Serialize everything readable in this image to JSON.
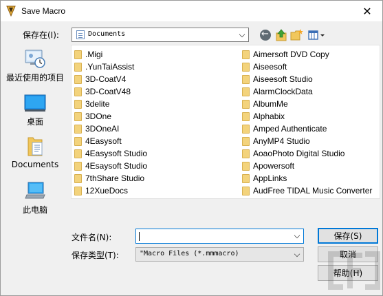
{
  "window": {
    "title": "Save Macro",
    "close_glyph": "✕"
  },
  "toolbar": {
    "savein_label": "保存在(I):",
    "savein_value": "Documents",
    "back_icon": "back-arrow-icon",
    "up_icon": "up-folder-icon",
    "newfolder_icon": "new-folder-icon",
    "views_icon": "views-menu-icon"
  },
  "places": [
    {
      "label": "最近使用的项目",
      "icon": "recent-items-icon"
    },
    {
      "label": "桌面",
      "icon": "desktop-icon"
    },
    {
      "label": "Documents",
      "icon": "documents-icon"
    },
    {
      "label": "此电脑",
      "icon": "this-pc-icon"
    }
  ],
  "files": {
    "column1": [
      ".Migi",
      ".YunTaiAssist",
      "3D-CoatV4",
      "3D-CoatV48",
      "3delite",
      "3DOne",
      "3DOneAI",
      "4Easysoft",
      "4Easysoft Studio",
      "4Esaysoft Studio",
      "7thShare Studio",
      "12XueDocs"
    ],
    "column2": [
      "Aimersoft DVD Copy",
      "Aiseesoft",
      "Aiseesoft Studio",
      "AlarmClockData",
      "AlbumMe",
      "Alphabix",
      "Amped Authenticate",
      "AnyMP4 Studio",
      "AoaoPhoto Digital Studio",
      "Apowersoft",
      "AppLinks",
      "AudFree TIDAL Music Converter"
    ]
  },
  "form": {
    "filename_label": "文件名(N):",
    "filename_value": "",
    "filetype_label": "保存类型(T):",
    "filetype_value": "\"Macro Files (*.mmmacro)"
  },
  "buttons": {
    "save": "保存(S)",
    "cancel": "取消",
    "help": "帮助(H)"
  },
  "colors": {
    "accent": "#0078d7",
    "folder": "#f3d37c",
    "dialog_bg": "#f0f0f0"
  }
}
